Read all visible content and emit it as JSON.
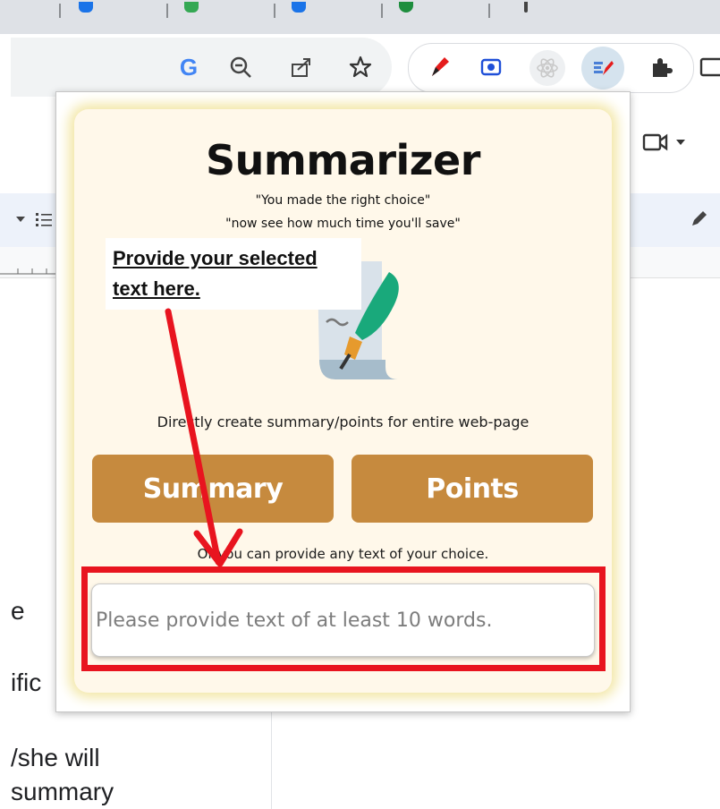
{
  "toolbar": {
    "icons": [
      "google-g-icon",
      "zoom-out-icon",
      "share-icon",
      "bookmark-star-icon",
      "red-pen-extension-icon",
      "screen-capture-extension-icon",
      "react-devtools-extension-icon",
      "summarizer-extension-icon",
      "extensions-puzzle-icon",
      "side-panel-icon"
    ],
    "google_letter": "G"
  },
  "popup": {
    "title": "Summarizer",
    "tagline_1": "\"You made the right choice\"",
    "tagline_2": "\"now see how much time you'll save\"",
    "direct_label": "Directly create summary/points for entire web-page",
    "summary_button": "Summary",
    "points_button": "Points",
    "or_label": "Or you can provide any text of your choice.",
    "input_placeholder": "Please provide text of at least 10 words."
  },
  "annotation": {
    "callout": "Provide your selected text here."
  },
  "document": {
    "fragments": [
      "e",
      "ific",
      "/she will",
      "summary"
    ]
  },
  "colors": {
    "button_bg": "#c68a3e",
    "card_bg": "#fff8ea",
    "annotation_red": "#e8141f"
  }
}
